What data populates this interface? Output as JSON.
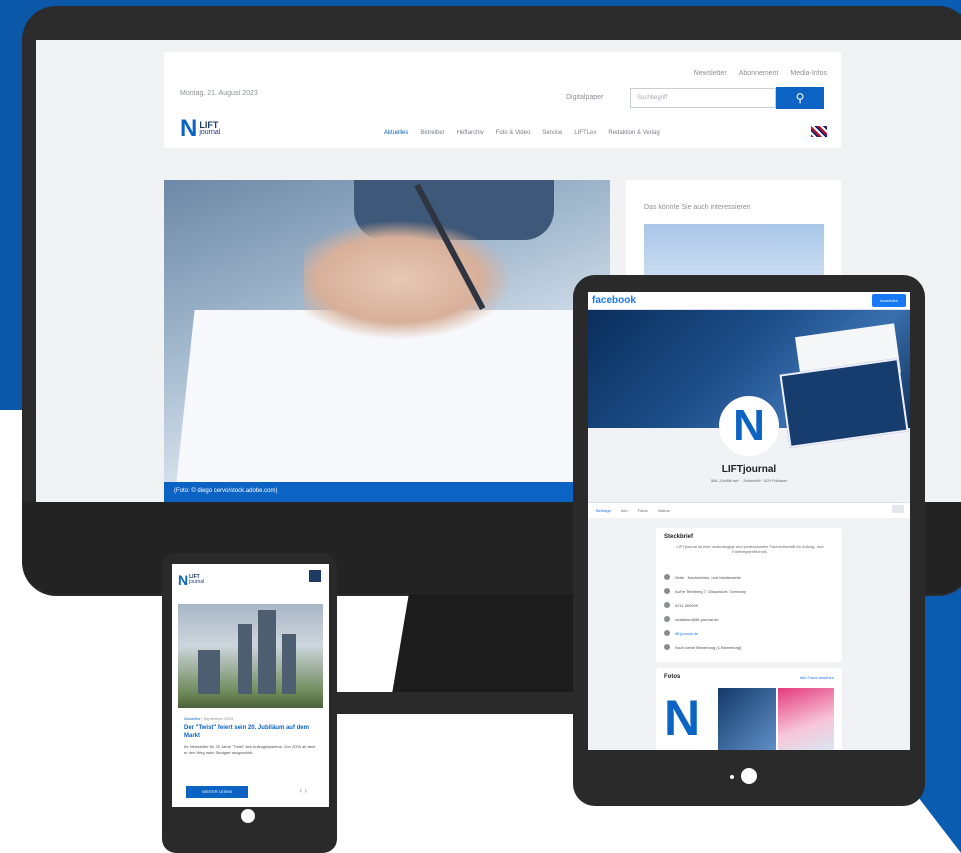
{
  "desktop": {
    "date": "Montag, 21. August 2023",
    "top_links": [
      "Newsletter",
      "Abonnement",
      "Media-Infos"
    ],
    "digi_label": "Digitalpaper",
    "search_placeholder": "Suchbegriff",
    "search_icon": "search-icon",
    "logo_mark": "N",
    "logo_line1": "LIFT",
    "logo_line2": "journal",
    "nav": [
      "Aktuelles",
      "Betreiber",
      "Heftarchiv",
      "Foto & Video",
      "Service",
      "LIFTLex",
      "Redaktion & Verlag"
    ],
    "hero_caption": "(Foto: © diego cervo/stock.adobe.com)",
    "aside_title": "Das könnte Sie auch interessieren"
  },
  "tablet": {
    "brand": "facebook",
    "action_button": "Anmelden",
    "avatar_mark": "N",
    "page_name": "LIFTjournal",
    "page_sub": "584 „Gefällt mir“ · Zeitschrift · 629 Follower",
    "tabs": [
      "Beiträge",
      "Info",
      "Fotos",
      "Videos"
    ],
    "profile": {
      "title": "Steckbrief",
      "intro": "LIFTjournal ist eine unabhängige und professionelle Fachzeitschrift für Aufzug- und Fahrtreppentechnik.",
      "rows": [
        {
          "icon": "info-icon",
          "text": "Seite · Nachrichten- und Medienseite"
        },
        {
          "icon": "location-icon",
          "text": "Auf'm Tetelberg 7, Düsseldorf, Germany"
        },
        {
          "icon": "phone-icon",
          "text": "0211 000000"
        },
        {
          "icon": "mail-icon",
          "text": "redaktion@lift-journal.de"
        },
        {
          "icon": "globe-icon",
          "text": "lift-journal.de"
        },
        {
          "icon": "rating-icon",
          "text": "Noch keine Bewertung (1 Bewertung)"
        }
      ]
    },
    "photos": {
      "title": "Fotos",
      "all_label": "Alle Fotos ansehen"
    }
  },
  "phone": {
    "logo_mark": "N",
    "logo_line1": "LIFT",
    "logo_line2": "journal",
    "meta_category": "Aktuelles",
    "meta_date": "| September 2023",
    "article_title": "Der \"Twist\" feiert sein 20. Jubiläum auf dem Markt",
    "article_text": "Ihr Newsletter für 20 Jahre \"Twist\" des Aufzugssystems: Von 2003 ab fand er den Weg nach Stuttgart ausgewählt.",
    "more_button": "WEITER LESEN",
    "arrows": "‹ ›"
  }
}
